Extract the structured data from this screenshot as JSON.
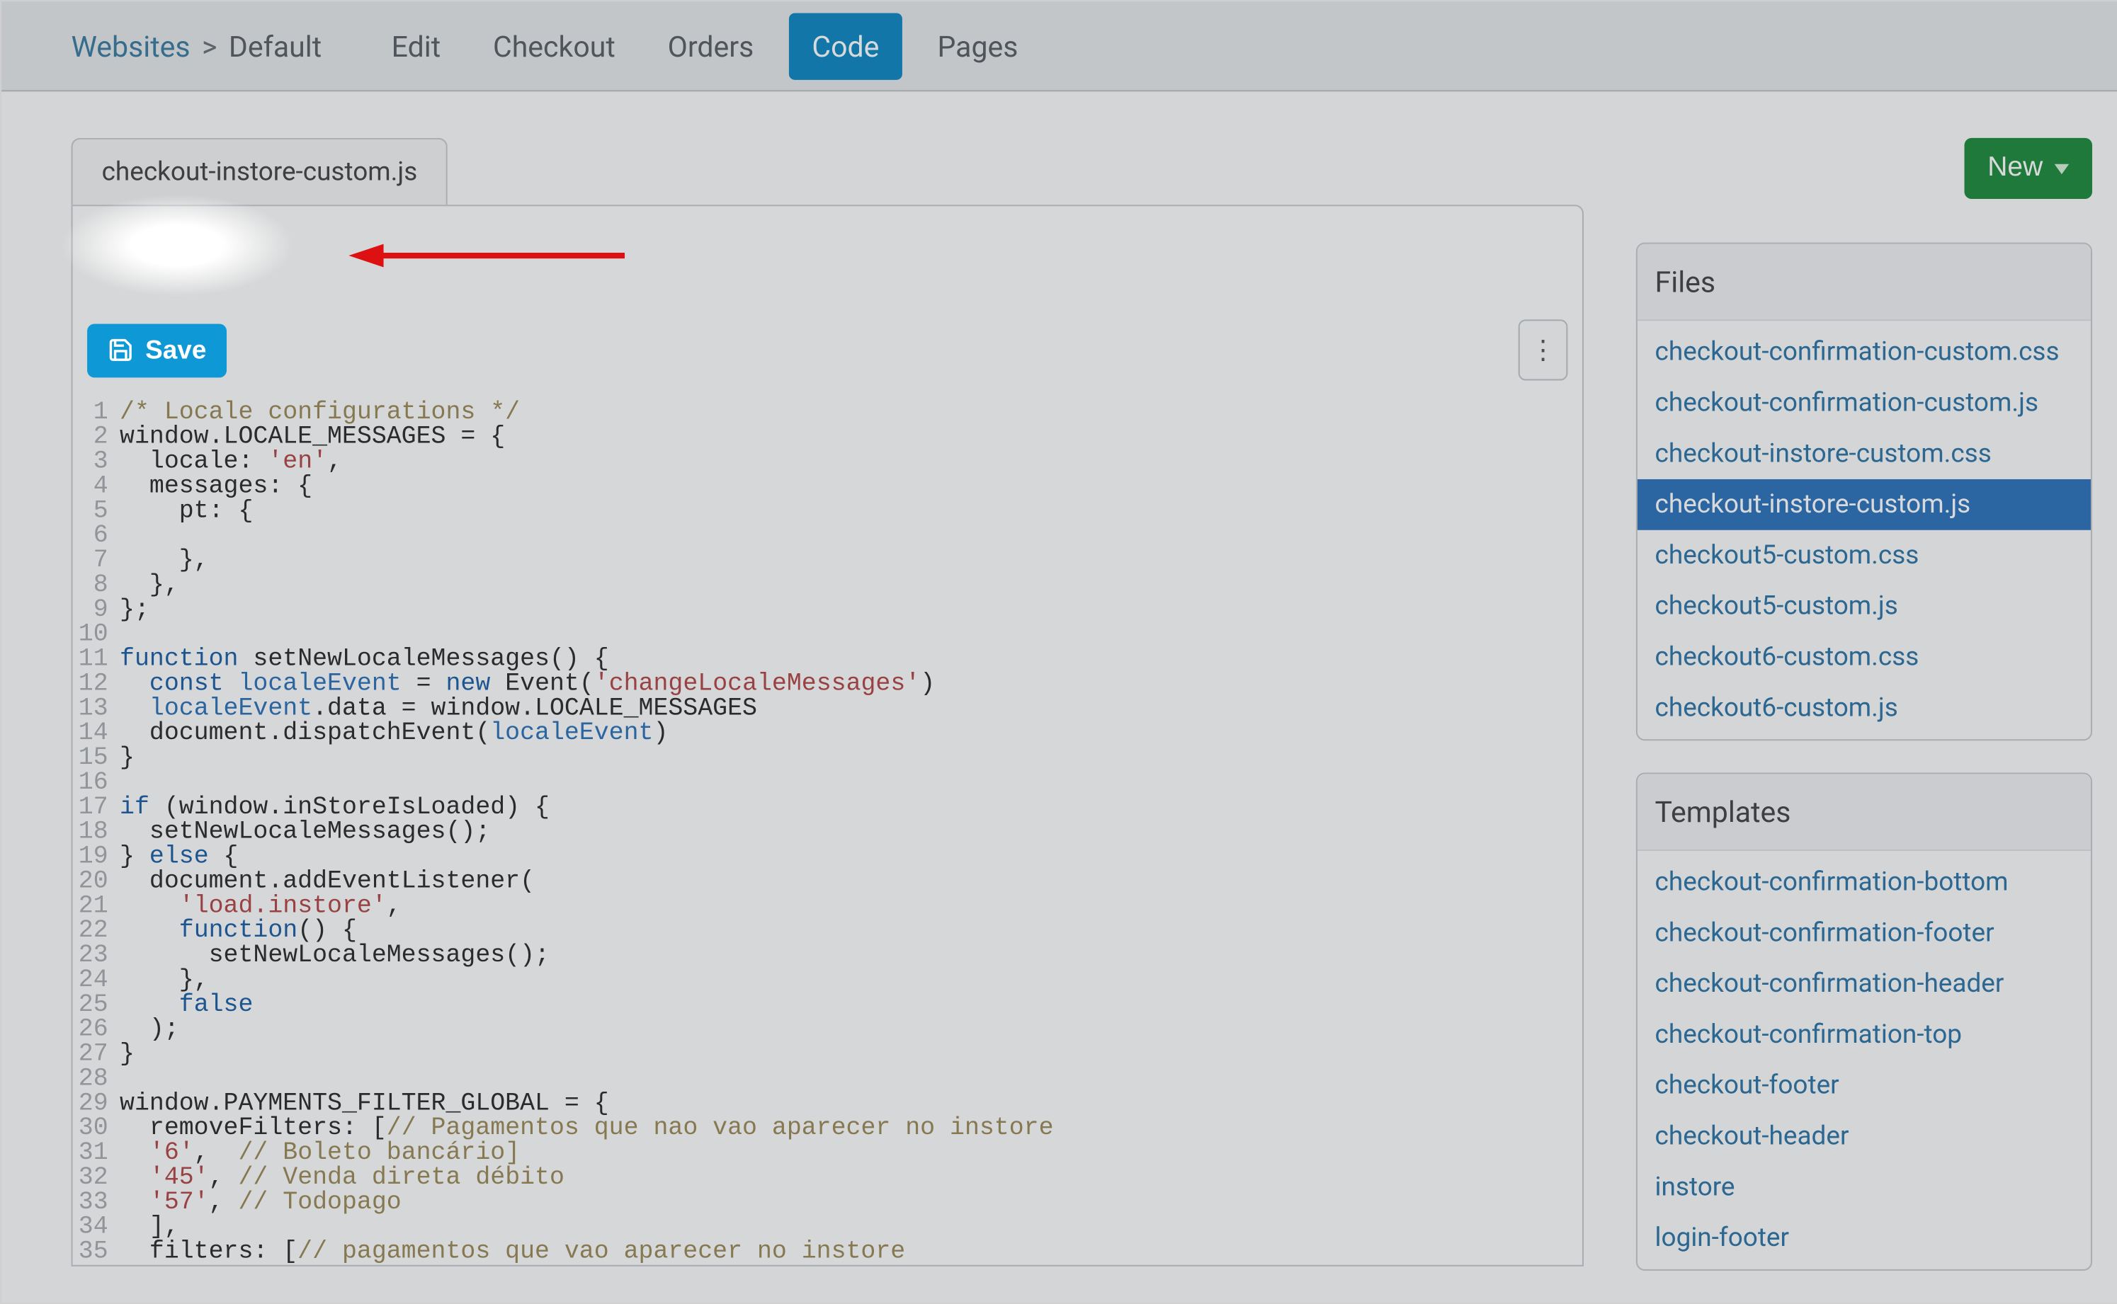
{
  "nav": {
    "breadcrumb": {
      "root": "Websites",
      "sep": ">",
      "current": "Default"
    },
    "items": [
      {
        "label": "Edit",
        "active": false
      },
      {
        "label": "Checkout",
        "active": false
      },
      {
        "label": "Orders",
        "active": false
      },
      {
        "label": "Code",
        "active": true
      },
      {
        "label": "Pages",
        "active": false
      }
    ]
  },
  "editor": {
    "file_tab": "checkout-instore-custom.js",
    "save_label": "Save",
    "kebab_glyph": "⋮",
    "code_lines": [
      {
        "n": 1,
        "segs": [
          {
            "c": "cm-comment",
            "t": "/* Locale configurations */"
          }
        ]
      },
      {
        "n": 2,
        "segs": [
          {
            "c": "",
            "t": "window.LOCALE_MESSAGES = {"
          }
        ]
      },
      {
        "n": 3,
        "segs": [
          {
            "c": "",
            "t": "  locale: "
          },
          {
            "c": "cm-str",
            "t": "'en'"
          },
          {
            "c": "",
            "t": ","
          }
        ]
      },
      {
        "n": 4,
        "segs": [
          {
            "c": "",
            "t": "  messages: {"
          }
        ]
      },
      {
        "n": 5,
        "segs": [
          {
            "c": "",
            "t": "    pt: {"
          }
        ]
      },
      {
        "n": 6,
        "segs": [
          {
            "c": "",
            "t": ""
          }
        ]
      },
      {
        "n": 7,
        "segs": [
          {
            "c": "",
            "t": "    },"
          }
        ]
      },
      {
        "n": 8,
        "segs": [
          {
            "c": "",
            "t": "  },"
          }
        ]
      },
      {
        "n": 9,
        "segs": [
          {
            "c": "",
            "t": "};"
          }
        ]
      },
      {
        "n": 10,
        "segs": [
          {
            "c": "",
            "t": ""
          }
        ]
      },
      {
        "n": 11,
        "segs": [
          {
            "c": "cm-kw",
            "t": "function"
          },
          {
            "c": "",
            "t": " setNewLocaleMessages() {"
          }
        ]
      },
      {
        "n": 12,
        "segs": [
          {
            "c": "",
            "t": "  "
          },
          {
            "c": "cm-kw",
            "t": "const"
          },
          {
            "c": "",
            "t": " "
          },
          {
            "c": "cm-id",
            "t": "localeEvent"
          },
          {
            "c": "",
            "t": " = "
          },
          {
            "c": "cm-kw",
            "t": "new"
          },
          {
            "c": "",
            "t": " Event("
          },
          {
            "c": "cm-str",
            "t": "'changeLocaleMessages'"
          },
          {
            "c": "",
            "t": ")"
          }
        ]
      },
      {
        "n": 13,
        "segs": [
          {
            "c": "",
            "t": "  "
          },
          {
            "c": "cm-id",
            "t": "localeEvent"
          },
          {
            "c": "",
            "t": ".data = window.LOCALE_MESSAGES"
          }
        ]
      },
      {
        "n": 14,
        "segs": [
          {
            "c": "",
            "t": "  document.dispatchEvent("
          },
          {
            "c": "cm-id",
            "t": "localeEvent"
          },
          {
            "c": "",
            "t": ")"
          }
        ]
      },
      {
        "n": 15,
        "segs": [
          {
            "c": "",
            "t": "}"
          }
        ]
      },
      {
        "n": 16,
        "segs": [
          {
            "c": "",
            "t": ""
          }
        ]
      },
      {
        "n": 17,
        "segs": [
          {
            "c": "cm-kw",
            "t": "if"
          },
          {
            "c": "",
            "t": " (window.inStoreIsLoaded) {"
          }
        ]
      },
      {
        "n": 18,
        "segs": [
          {
            "c": "",
            "t": "  setNewLocaleMessages();"
          }
        ]
      },
      {
        "n": 19,
        "segs": [
          {
            "c": "",
            "t": "} "
          },
          {
            "c": "cm-kw",
            "t": "else"
          },
          {
            "c": "",
            "t": " {"
          }
        ]
      },
      {
        "n": 20,
        "segs": [
          {
            "c": "",
            "t": "  document.addEventListener("
          }
        ]
      },
      {
        "n": 21,
        "segs": [
          {
            "c": "",
            "t": "    "
          },
          {
            "c": "cm-str",
            "t": "'load.instore'"
          },
          {
            "c": "",
            "t": ","
          }
        ]
      },
      {
        "n": 22,
        "segs": [
          {
            "c": "",
            "t": "    "
          },
          {
            "c": "cm-kw",
            "t": "function"
          },
          {
            "c": "",
            "t": "() {"
          }
        ]
      },
      {
        "n": 23,
        "segs": [
          {
            "c": "",
            "t": "      setNewLocaleMessages();"
          }
        ]
      },
      {
        "n": 24,
        "segs": [
          {
            "c": "",
            "t": "    },"
          }
        ]
      },
      {
        "n": 25,
        "segs": [
          {
            "c": "",
            "t": "    "
          },
          {
            "c": "cm-kw",
            "t": "false"
          }
        ]
      },
      {
        "n": 26,
        "segs": [
          {
            "c": "",
            "t": "  );"
          }
        ]
      },
      {
        "n": 27,
        "segs": [
          {
            "c": "",
            "t": "}"
          }
        ]
      },
      {
        "n": 28,
        "segs": [
          {
            "c": "",
            "t": ""
          }
        ]
      },
      {
        "n": 29,
        "segs": [
          {
            "c": "",
            "t": "window.PAYMENTS_FILTER_GLOBAL = {"
          }
        ]
      },
      {
        "n": 30,
        "segs": [
          {
            "c": "",
            "t": "  removeFilters: ["
          },
          {
            "c": "cm-comment",
            "t": "// Pagamentos que nao vao aparecer no instore"
          }
        ]
      },
      {
        "n": 31,
        "segs": [
          {
            "c": "",
            "t": "  "
          },
          {
            "c": "cm-str",
            "t": "'6'"
          },
          {
            "c": "",
            "t": ",  "
          },
          {
            "c": "cm-comment",
            "t": "// Boleto bancário]"
          }
        ]
      },
      {
        "n": 32,
        "segs": [
          {
            "c": "",
            "t": "  "
          },
          {
            "c": "cm-str",
            "t": "'45'"
          },
          {
            "c": "",
            "t": ", "
          },
          {
            "c": "cm-comment",
            "t": "// Venda direta débito"
          }
        ]
      },
      {
        "n": 33,
        "segs": [
          {
            "c": "",
            "t": "  "
          },
          {
            "c": "cm-str",
            "t": "'57'"
          },
          {
            "c": "",
            "t": ", "
          },
          {
            "c": "cm-comment",
            "t": "// Todopago"
          }
        ]
      },
      {
        "n": 34,
        "segs": [
          {
            "c": "",
            "t": "  ],"
          }
        ]
      },
      {
        "n": 35,
        "segs": [
          {
            "c": "",
            "t": "  filters: ["
          },
          {
            "c": "cm-comment",
            "t": "// pagamentos que vao aparecer no instore"
          }
        ]
      }
    ]
  },
  "right": {
    "new_label": "New",
    "files_title": "Files",
    "files": [
      {
        "label": "checkout-confirmation-custom.css",
        "active": false
      },
      {
        "label": "checkout-confirmation-custom.js",
        "active": false
      },
      {
        "label": "checkout-instore-custom.css",
        "active": false
      },
      {
        "label": "checkout-instore-custom.js",
        "active": true
      },
      {
        "label": "checkout5-custom.css",
        "active": false
      },
      {
        "label": "checkout5-custom.js",
        "active": false
      },
      {
        "label": "checkout6-custom.css",
        "active": false
      },
      {
        "label": "checkout6-custom.js",
        "active": false
      }
    ],
    "templates_title": "Templates",
    "templates": [
      {
        "label": "checkout-confirmation-bottom"
      },
      {
        "label": "checkout-confirmation-footer"
      },
      {
        "label": "checkout-confirmation-header"
      },
      {
        "label": "checkout-confirmation-top"
      },
      {
        "label": "checkout-footer"
      },
      {
        "label": "checkout-header"
      },
      {
        "label": "instore"
      },
      {
        "label": "login-footer"
      }
    ]
  }
}
